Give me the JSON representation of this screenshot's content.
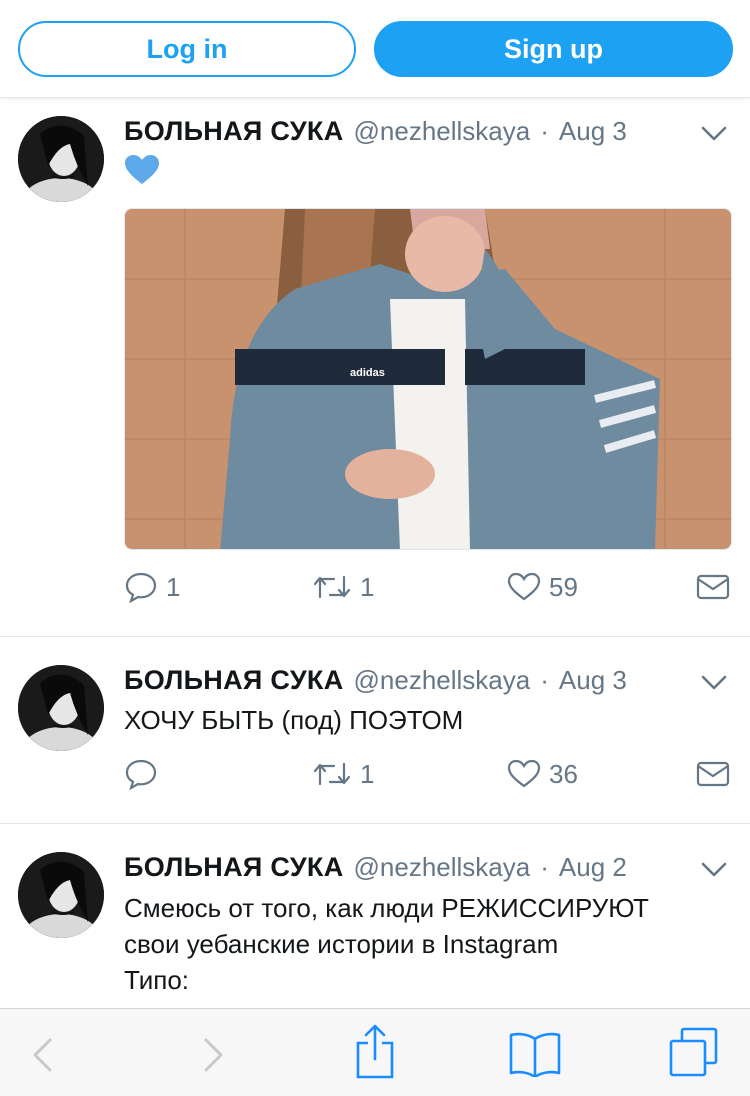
{
  "header": {
    "login_label": "Log in",
    "signup_label": "Sign up"
  },
  "tweets": [
    {
      "name": "БОЛЬНАЯ СУКА",
      "handle": "@nezhellskaya",
      "sep": "·",
      "date": "Aug 3",
      "emoji": "blue-heart",
      "media_logo": "adidas",
      "replies": "1",
      "retweets": "1",
      "likes": "59"
    },
    {
      "name": "БОЛЬНАЯ СУКА",
      "handle": "@nezhellskaya",
      "sep": "·",
      "date": "Aug 3",
      "text": "ХОЧУ БЫТЬ (под) ПОЭТОМ",
      "replies": "",
      "retweets": "1",
      "likes": "36"
    },
    {
      "name": "БОЛЬНАЯ СУКА",
      "handle": "@nezhellskaya",
      "sep": "·",
      "date": "Aug 2",
      "lines": [
        "Смеюсь от того, как люди РЕЖИССИРУЮТ",
        "свои уебанские истории в Instagram",
        "Типо:"
      ]
    }
  ],
  "colors": {
    "accent": "#1da1f2",
    "muted": "#657786",
    "divider": "#e1e8ed",
    "heart": "#5ea9ea"
  },
  "icons": [
    "reply-icon",
    "retweet-icon",
    "like-icon",
    "dm-icon",
    "chevron-down-icon",
    "back-icon",
    "forward-icon",
    "share-icon",
    "bookmarks-icon",
    "tabs-icon"
  ]
}
